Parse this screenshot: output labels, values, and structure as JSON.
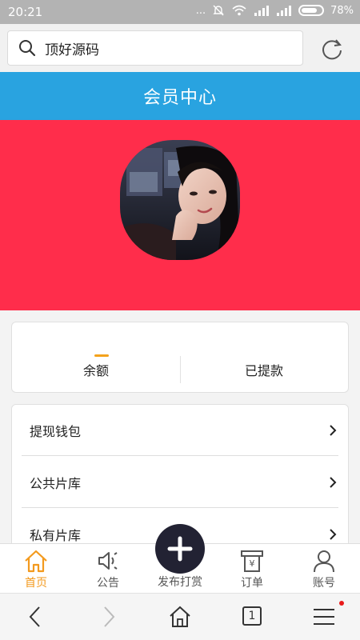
{
  "status_bar": {
    "time": "20:21",
    "dots": "...",
    "battery": "78%",
    "battery_level": 0.78
  },
  "url_bar": {
    "site_name": "顶好源码"
  },
  "header": {
    "title": "会员中心"
  },
  "balance": {
    "balance_label": "余额",
    "withdrawn_label": "已提款"
  },
  "menu": {
    "items": [
      {
        "label": "提现钱包"
      },
      {
        "label": "公共片库"
      },
      {
        "label": "私有片库"
      }
    ]
  },
  "tabs": {
    "home": "首页",
    "notice": "公告",
    "publish": "发布打赏",
    "orders": "订单",
    "account": "账号"
  },
  "nav": {
    "tab_count": "1"
  },
  "colors": {
    "header_bg": "#29a3e0",
    "hero_bg": "#ff2d4b",
    "active_tab": "#f39a1e"
  }
}
